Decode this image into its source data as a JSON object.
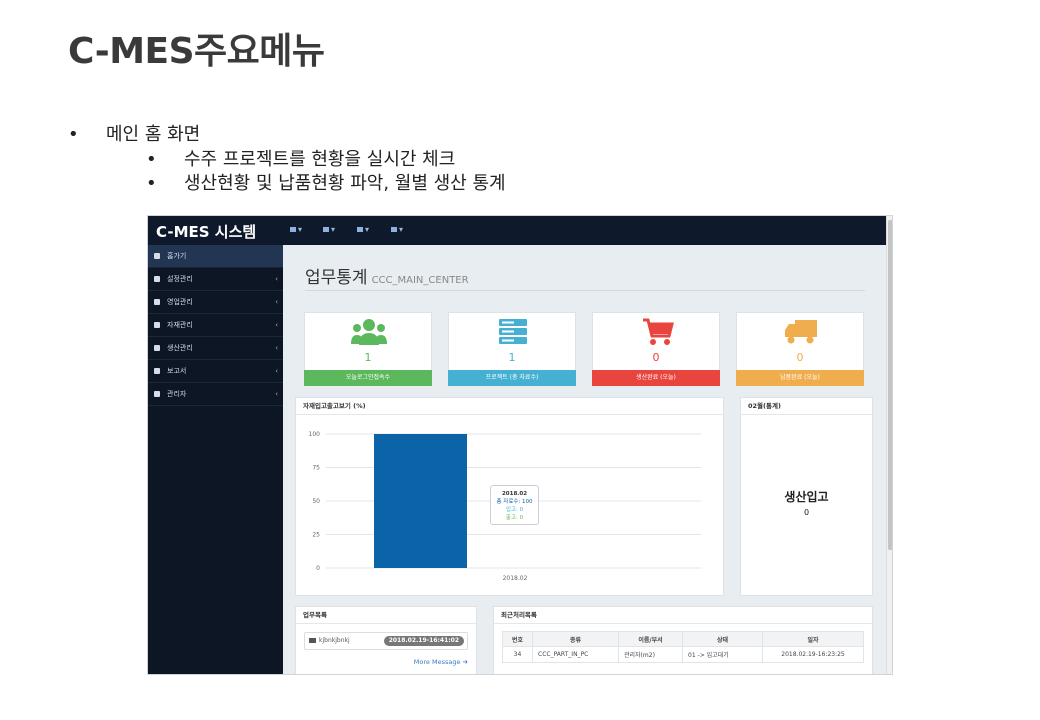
{
  "slide": {
    "title": "C-MES주요메뉴",
    "bullet_1": "메인 홈 화면",
    "sub_bullets": [
      "수주 프로젝트를 현황을 실시간 체크",
      "생산현황 및 납품현황 파악, 월별 생산 통계"
    ]
  },
  "app": {
    "brand": "C-MES 시스템",
    "top_icons": [
      "envelope-icon",
      "list-icon",
      "bell-icon",
      "user-icon"
    ]
  },
  "sidebar": {
    "items": [
      {
        "label": "홈가기",
        "icon": "file-icon",
        "active": true
      },
      {
        "label": "설정관리",
        "icon": "wrench-icon"
      },
      {
        "label": "영업관리",
        "icon": "wrench-icon"
      },
      {
        "label": "자재관리",
        "icon": "cubes-icon"
      },
      {
        "label": "생산관리",
        "icon": "edit-icon"
      },
      {
        "label": "보고서",
        "icon": "report-icon"
      },
      {
        "label": "관리자",
        "icon": "sliders-icon"
      }
    ]
  },
  "page": {
    "title": "업무통계",
    "subtitle": "CCC_MAIN_CENTER"
  },
  "stats": [
    {
      "value": "1",
      "label": "오늘로그인접속수",
      "color": "#5cb85c",
      "icon": "users-icon"
    },
    {
      "value": "1",
      "label": "프로젝트 (총 자료수)",
      "color": "#46b0d3",
      "icon": "server-icon"
    },
    {
      "value": "0",
      "label": "생산완료 (오늘)",
      "color": "#e9453f",
      "icon": "cart-icon"
    },
    {
      "value": "0",
      "label": "납품완료 (오늘)",
      "color": "#f0ad4e",
      "icon": "truck-icon"
    }
  ],
  "chart_panel": {
    "title": "자재입고출고보기 (%)"
  },
  "chart_data": {
    "type": "bar",
    "categories": [
      "2018.02"
    ],
    "series": [
      {
        "name": "",
        "values": [
          100
        ]
      }
    ],
    "yticks": [
      100,
      75,
      50,
      25,
      0
    ],
    "ylim": [
      0,
      100
    ],
    "bar_color": "#0b64a7",
    "tooltip": {
      "title": "2018.02",
      "line1": "총 자료수: 100",
      "line2": "입고: 0",
      "line3": "출고: 0"
    }
  },
  "month_panel": {
    "title": "02월(통계)",
    "label": "생산입고",
    "value": "0"
  },
  "todo_panel": {
    "title": "업무목록",
    "item_text": "kjbnkjbnkj",
    "item_time": "2018.02.19-16:41:02",
    "more": "More Message"
  },
  "recent_panel": {
    "title": "최근처리목록",
    "headers": [
      "번호",
      "종류",
      "이름/부서",
      "상태",
      "일자"
    ],
    "rows": [
      [
        "34",
        "CCC_PART_IN_PC",
        "관리자(m2)",
        "01 -> 입고대기",
        "2018.02.19-16:23:25"
      ]
    ]
  }
}
